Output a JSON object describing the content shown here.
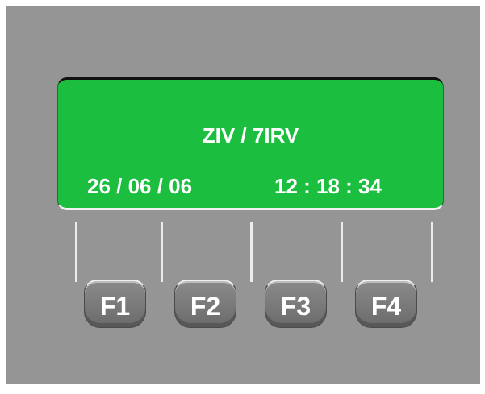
{
  "display": {
    "title": "ZIV / 7IRV",
    "date": "26 / 06 / 06",
    "time": "12 : 18 : 34"
  },
  "function_keys": [
    {
      "label": "F1"
    },
    {
      "label": "F2"
    },
    {
      "label": "F3"
    },
    {
      "label": "F4"
    }
  ],
  "colors": {
    "panel": "#959595",
    "lcd_background": "#1cbe3f",
    "lcd_text": "#ffffff",
    "key_face": "#7e7e7e"
  }
}
